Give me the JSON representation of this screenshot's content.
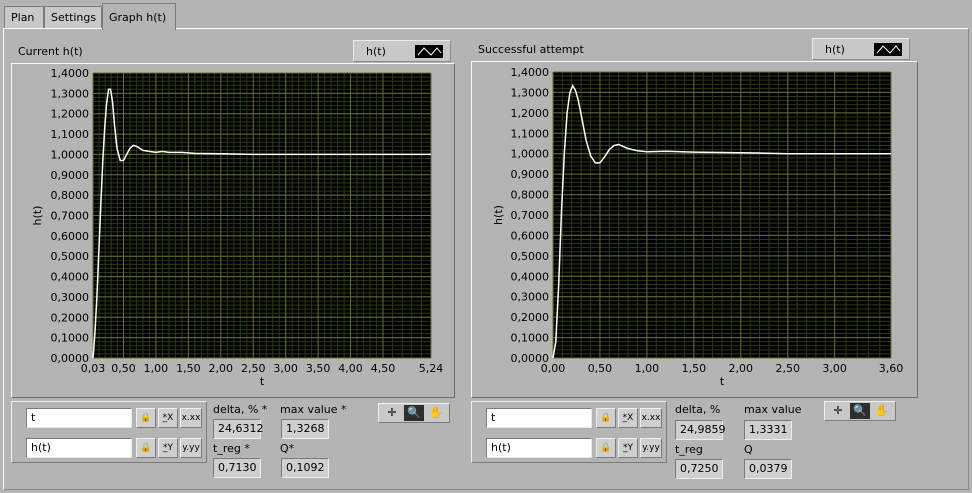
{
  "tabs": [
    {
      "label": "Plan"
    },
    {
      "label": "Settings"
    },
    {
      "label": "Graph h(t)"
    }
  ],
  "left_panel": {
    "title": "Current h(t)",
    "legend": {
      "label": "h(t)"
    },
    "cursor_fields": {
      "x_value": "t",
      "y_value": "h(t)"
    },
    "scale_buttons": {
      "lock": "🔒",
      "x_autoscale": "*̲X",
      "x_format": "x.xx",
      "y_autoscale": "*̲Y",
      "y_format": "y.yy"
    },
    "metrics": {
      "delta_label": "delta, % *",
      "delta_value": "24,6312",
      "max_label": "max value *",
      "max_value": "1,3268",
      "treg_label": "t_reg *",
      "treg_value": "0,7130",
      "q_label": "Q*",
      "q_value": "0,1092"
    }
  },
  "right_panel": {
    "title": "Successful attempt",
    "legend": {
      "label": "h(t)"
    },
    "cursor_fields": {
      "x_value": "t",
      "y_value": "h(t)"
    },
    "scale_buttons": {
      "lock": "🔒",
      "x_autoscale": "*̲X",
      "x_format": "x.xx",
      "y_autoscale": "*̲Y",
      "y_format": "y.yy"
    },
    "metrics": {
      "delta_label": "delta, %",
      "delta_value": "24,9859",
      "max_label": "max value",
      "max_value": "1,3331",
      "treg_label": "t_reg",
      "treg_value": "0,7250",
      "q_label": "Q",
      "q_value": "0,0379"
    }
  },
  "tool_palette": {
    "cursor": "✛",
    "zoom": "🔍",
    "pan": "✋"
  },
  "chart_data": [
    {
      "type": "line",
      "title": "Current h(t)",
      "xlabel": "t",
      "ylabel": "h(t)",
      "xlim": [
        0.03,
        5.24
      ],
      "ylim": [
        0,
        1.4
      ],
      "x_ticks": [
        "0,03",
        "0,50",
        "1,00",
        "1,50",
        "2,00",
        "2,50",
        "3,00",
        "3,50",
        "4,00",
        "4,50",
        "5,24"
      ],
      "x_tick_values": [
        0.03,
        0.5,
        1.0,
        1.5,
        2.0,
        2.5,
        3.0,
        3.5,
        4.0,
        4.5,
        5.24
      ],
      "y_ticks": [
        "0,0000",
        "0,1000",
        "0,2000",
        "0,3000",
        "0,4000",
        "0,5000",
        "0,6000",
        "0,7000",
        "0,8000",
        "0,9000",
        "1,0000",
        "1,1000",
        "1,2000",
        "1,3000",
        "1,4000"
      ],
      "grid": true,
      "series": [
        {
          "color": "#ffffff",
          "x": [
            0.03,
            0.06,
            0.09,
            0.12,
            0.15,
            0.18,
            0.21,
            0.24,
            0.27,
            0.3,
            0.33,
            0.36,
            0.4,
            0.45,
            0.5,
            0.55,
            0.6,
            0.65,
            0.7,
            0.75,
            0.8,
            0.9,
            1.0,
            1.1,
            1.2,
            1.4,
            1.6,
            2.0,
            2.5,
            3.0,
            3.5,
            4.0,
            4.5,
            5.24
          ],
          "y": [
            0.0,
            0.12,
            0.3,
            0.52,
            0.75,
            0.96,
            1.13,
            1.25,
            1.32,
            1.32,
            1.26,
            1.15,
            1.03,
            0.97,
            0.97,
            1.0,
            1.03,
            1.045,
            1.04,
            1.03,
            1.02,
            1.015,
            1.01,
            1.015,
            1.01,
            1.01,
            1.005,
            1.003,
            1.0,
            1.0,
            1.0,
            1.0,
            1.0,
            1.0
          ]
        }
      ]
    },
    {
      "type": "line",
      "title": "Successful attempt",
      "xlabel": "t",
      "ylabel": "h(t)",
      "xlim": [
        0,
        3.6
      ],
      "ylim": [
        0,
        1.4
      ],
      "x_ticks": [
        "0,00",
        "0,50",
        "1,00",
        "1,50",
        "2,00",
        "2,50",
        "3,00",
        "3,60"
      ],
      "x_tick_values": [
        0,
        0.5,
        1.0,
        1.5,
        2.0,
        2.5,
        3.0,
        3.6
      ],
      "y_ticks": [
        "0,0000",
        "0,1000",
        "0,2000",
        "0,3000",
        "0,4000",
        "0,5000",
        "0,6000",
        "0,7000",
        "0,8000",
        "0,9000",
        "1,0000",
        "1,1000",
        "1,2000",
        "1,3000",
        "1,4000"
      ],
      "grid": true,
      "series": [
        {
          "color": "#ffffff",
          "x": [
            0.0,
            0.03,
            0.06,
            0.09,
            0.12,
            0.15,
            0.18,
            0.21,
            0.24,
            0.27,
            0.3,
            0.35,
            0.4,
            0.45,
            0.5,
            0.55,
            0.6,
            0.65,
            0.7,
            0.75,
            0.8,
            0.9,
            1.0,
            1.2,
            1.5,
            2.0,
            2.5,
            3.0,
            3.6
          ],
          "y": [
            0.0,
            0.08,
            0.35,
            0.72,
            1.0,
            1.2,
            1.3,
            1.333,
            1.31,
            1.26,
            1.19,
            1.07,
            0.99,
            0.955,
            0.955,
            0.985,
            1.02,
            1.04,
            1.045,
            1.035,
            1.025,
            1.015,
            1.01,
            1.012,
            1.008,
            1.005,
            1.0,
            1.0,
            1.0
          ]
        }
      ]
    }
  ]
}
